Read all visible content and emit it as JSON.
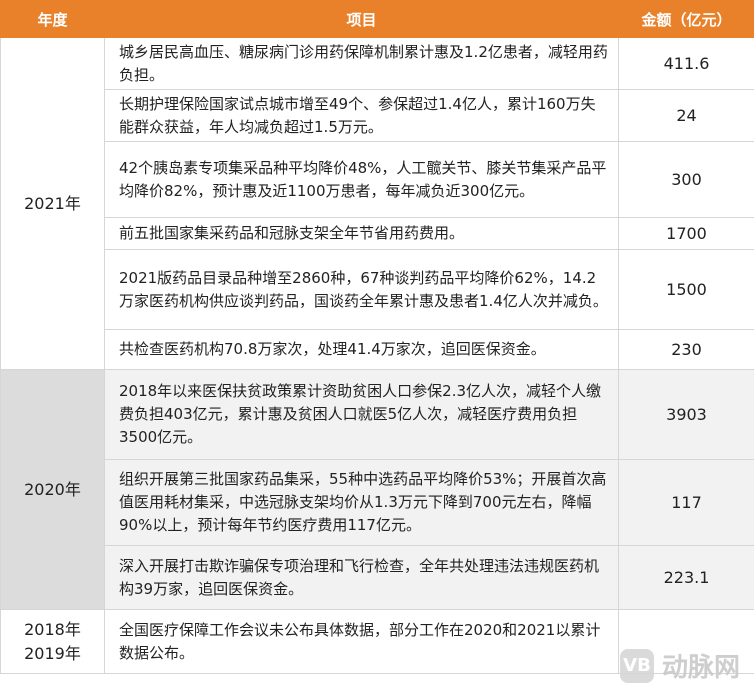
{
  "headers": {
    "year": "年度",
    "item": "项目",
    "amount": "金额（亿元）"
  },
  "groups": [
    {
      "year": "2021年",
      "rows": [
        {
          "item": "城乡居民高血压、糖尿病门诊用药保障机制累计惠及1.2亿患者，减轻用药负担。",
          "amount": "411.6"
        },
        {
          "item": "长期护理保险国家试点城市增至49个、参保超过1.4亿人，累计160万失能群众获益，年人均减负超过1.5万元。",
          "amount": "24"
        },
        {
          "item": "42个胰岛素专项集采品种平均降价48%，人工髋关节、膝关节集采产品平均降价82%，预计惠及近1100万患者，每年减负近300亿元。",
          "amount": "300"
        },
        {
          "item": "前五批国家集采药品和冠脉支架全年节省用药费用。",
          "amount": "1700"
        },
        {
          "item": "2021版药品目录品种增至2860种，67种谈判药品平均降价62%，14.2万家医药机构供应谈判药品，国谈药全年累计惠及患者1.4亿人次并减负。",
          "amount": "1500"
        },
        {
          "item": "共检查医药机构70.8万家次，处理41.4万家次，追回医保资金。",
          "amount": "230"
        }
      ]
    },
    {
      "year": "2020年",
      "rows": [
        {
          "item": "2018年以来医保扶贫政策累计资助贫困人口参保2.3亿人次，减轻个人缴费负担403亿元，累计惠及贫困人口就医5亿人次，减轻医疗费用负担3500亿元。",
          "amount": "3903"
        },
        {
          "item": "组织开展第三批国家药品集采，55种中选药品平均降价53%；开展首次高值医用耗材集采，中选冠脉支架均价从1.3万元下降到700元左右，降幅90%以上，预计每年节约医疗费用117亿元。",
          "amount": "117"
        },
        {
          "item": "深入开展打击欺诈骗保专项治理和飞行检查，全年共处理违法违规医药机构39万家，追回医保资金。",
          "amount": "223.1"
        }
      ]
    },
    {
      "year_lines": [
        "2018年",
        "2019年"
      ],
      "rows": [
        {
          "item": "全国医疗保障工作会议未公布具体数据，部分工作在2020和2021以累计数据公布。",
          "amount": ""
        }
      ]
    }
  ],
  "watermark": {
    "logo": "VB",
    "text": "动脉网"
  },
  "colors": {
    "header_bg": "#e8812a",
    "group2020_year_bg": "#dcdcdc",
    "group2020_row_bg": "#f2f2f2",
    "border": "#d6d6d6"
  }
}
